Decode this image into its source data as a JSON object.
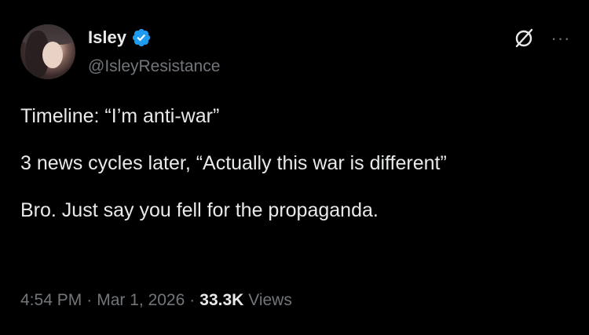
{
  "author": {
    "display_name": "Isley",
    "handle": "@IsleyResistance",
    "verified": true
  },
  "tweet": {
    "lines": [
      "Timeline: “I’m anti-war”",
      "3 news cycles later, “Actually this war is different”",
      "Bro. Just say you fell for the propaganda."
    ]
  },
  "meta": {
    "time": "4:54 PM",
    "separator": "·",
    "date": "Mar 1, 2026",
    "views_count": "33.3K",
    "views_label": "Views"
  },
  "actions": {
    "more_label": "···"
  },
  "colors": {
    "background": "#000000",
    "primary_text": "#e7e9ea",
    "secondary_text": "#71767b",
    "verified_blue": "#1d9bf0"
  },
  "icons": {
    "verified": "verified-badge-icon",
    "grok": "grok-icon",
    "more": "more-icon"
  }
}
